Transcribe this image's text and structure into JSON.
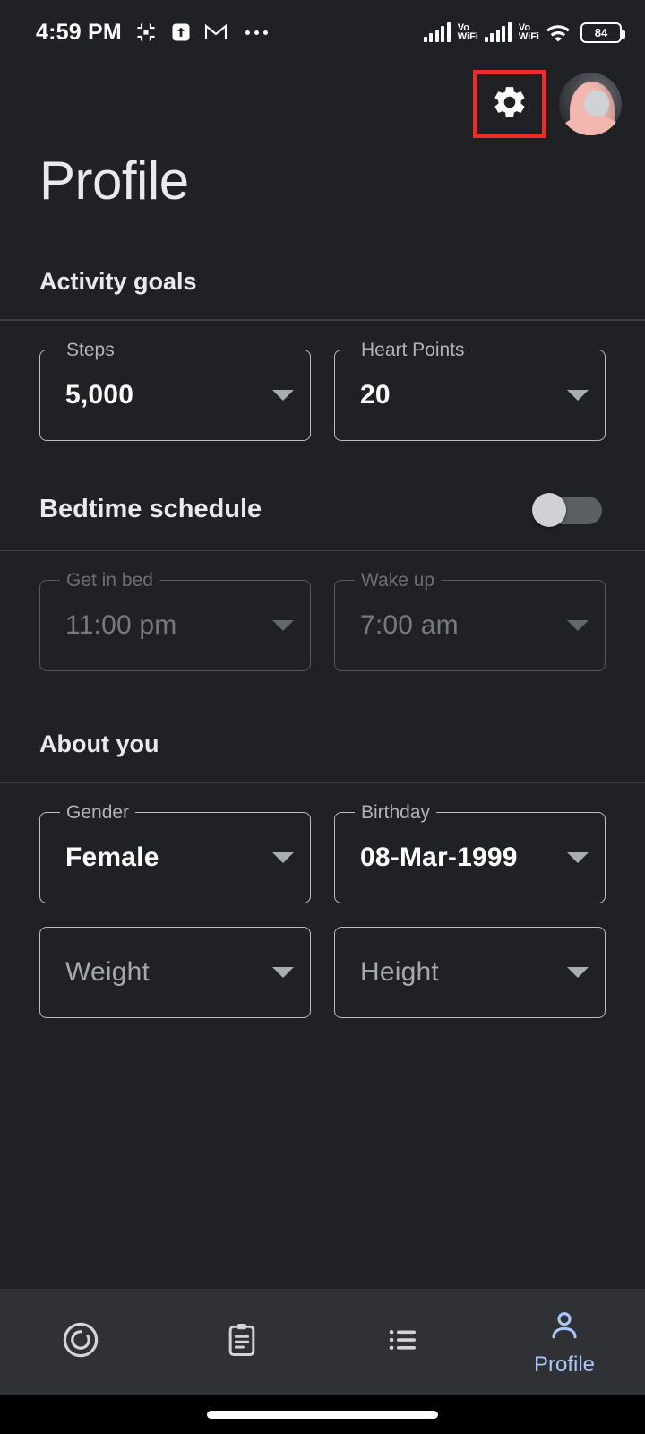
{
  "status_bar": {
    "time": "4:59 PM",
    "left_icons": [
      "slack-icon",
      "upload-icon",
      "gmail-icon",
      "overflow-dots-icon"
    ],
    "signal_1_label": "Vo\nWiFi",
    "signal_1_line1": "Vo",
    "signal_1_line2": "WiFi",
    "signal_2_line1": "Vo",
    "signal_2_line2": "WiFi",
    "wifi_icon": "wifi-icon",
    "battery_level": "84"
  },
  "topbar": {
    "settings_icon": "gear-icon",
    "avatar": "user-avatar",
    "highlight_color": "#ef2b2b"
  },
  "page": {
    "title": "Profile"
  },
  "sections": {
    "activity_goals": {
      "heading": "Activity goals",
      "fields": [
        {
          "label": "Steps",
          "value": "5,000",
          "disabled": false,
          "empty": false
        },
        {
          "label": "Heart Points",
          "value": "20",
          "disabled": false,
          "empty": false
        }
      ]
    },
    "bedtime": {
      "label": "Bedtime schedule",
      "toggle_state": "off",
      "fields": [
        {
          "label": "Get in bed",
          "value": "11:00 pm",
          "disabled": true,
          "empty": false
        },
        {
          "label": "Wake up",
          "value": "7:00 am",
          "disabled": true,
          "empty": false
        }
      ]
    },
    "about_you": {
      "heading": "About you",
      "fields_row1": [
        {
          "label": "Gender",
          "value": "Female",
          "disabled": false,
          "empty": false
        },
        {
          "label": "Birthday",
          "value": "08-Mar-1999",
          "disabled": false,
          "empty": false
        }
      ],
      "fields_row2": [
        {
          "label": "Weight",
          "value": "Weight",
          "disabled": false,
          "empty": true
        },
        {
          "label": "Height",
          "value": "Height",
          "disabled": false,
          "empty": true
        }
      ]
    }
  },
  "bottom_nav": {
    "active_color": "#a8c7fa",
    "items": [
      {
        "icon": "activity-ring-icon",
        "label": ""
      },
      {
        "icon": "journal-clipboard-icon",
        "label": ""
      },
      {
        "icon": "list-icon",
        "label": ""
      },
      {
        "icon": "person-icon",
        "label": "Profile"
      }
    ]
  }
}
